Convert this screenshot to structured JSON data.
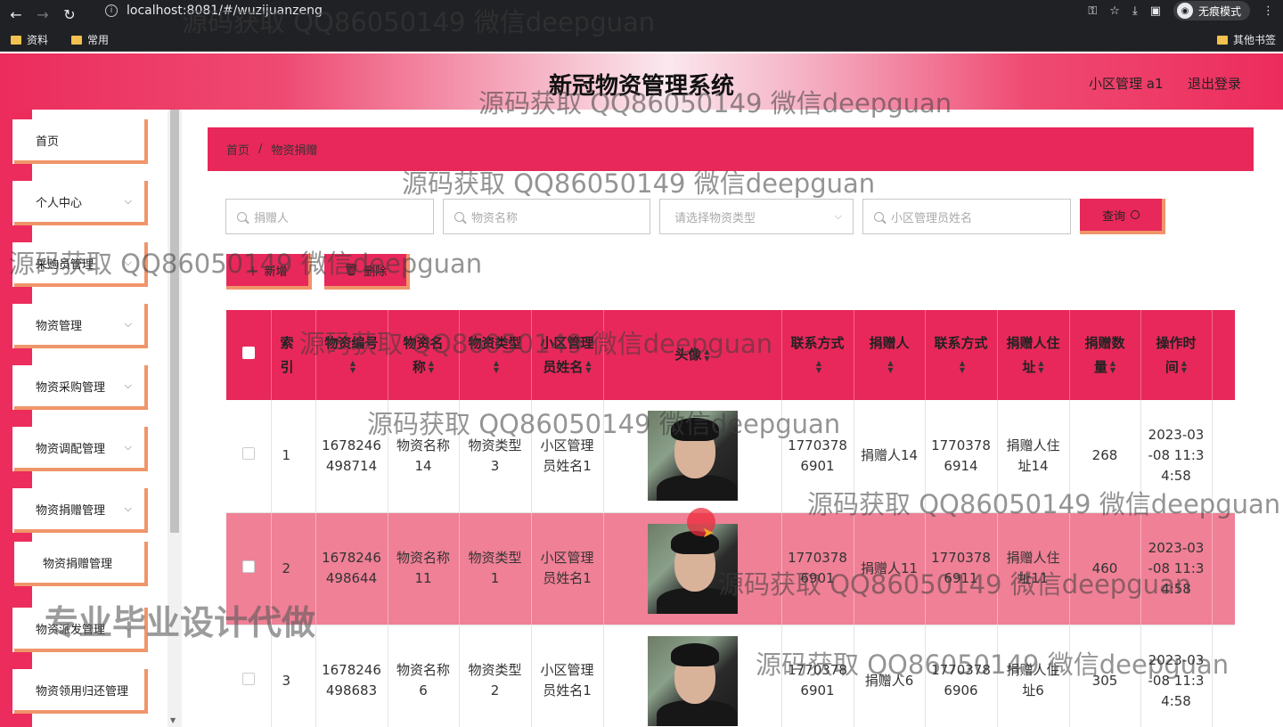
{
  "browser": {
    "url": "localhost:8081/#/wuzijuanzeng",
    "incognito_label": "无痕模式",
    "bookmarks": [
      "资料",
      "常用"
    ],
    "other_bookmarks": "其他书签"
  },
  "header": {
    "title": "新冠物资管理系统",
    "user": "小区管理 a1",
    "logout": "退出登录"
  },
  "sidebar": {
    "items": [
      {
        "label": "首页",
        "has_chevron": false
      },
      {
        "label": "个人中心",
        "has_chevron": true
      },
      {
        "label": "采购员管理",
        "has_chevron": true
      },
      {
        "label": "物资管理",
        "has_chevron": true
      },
      {
        "label": "物资采购管理",
        "has_chevron": true
      },
      {
        "label": "物资调配管理",
        "has_chevron": true
      },
      {
        "label": "物资捐赠管理",
        "has_chevron": true
      },
      {
        "label": "物资捐赠管理",
        "has_chevron": false,
        "submenu": true
      },
      {
        "label": "物资派发管理",
        "has_chevron": true
      },
      {
        "label": "物资领用归还管理",
        "has_chevron": false
      }
    ]
  },
  "breadcrumb": {
    "home": "首页",
    "separator": "/",
    "current": "物资捐赠"
  },
  "search": {
    "donor_placeholder": "捐赠人",
    "name_placeholder": "物资名称",
    "type_placeholder": "请选择物资类型",
    "admin_placeholder": "小区管理员姓名",
    "query_label": "查询"
  },
  "actions": {
    "add_label": "新增",
    "delete_label": "删除"
  },
  "table": {
    "headers": [
      "索引",
      "物资编号",
      "物资名称",
      "物资类型",
      "小区管理员姓名",
      "头像",
      "联系方式",
      "捐赠人",
      "联系方式",
      "捐赠人住址",
      "捐赠数量",
      "操作时间"
    ],
    "rows": [
      {
        "index": "1",
        "code": "1678246498714",
        "name": "物资名称14",
        "type": "物资类型3",
        "admin": "小区管理员姓名1",
        "phone1": "17703786901",
        "donor": "捐赠人14",
        "phone2": "17703786914",
        "address": "捐赠人住址14",
        "qty": "268",
        "time": "2023-03-08 11:34:58"
      },
      {
        "index": "2",
        "code": "1678246498644",
        "name": "物资名称11",
        "type": "物资类型1",
        "admin": "小区管理员姓名1",
        "phone1": "17703786901",
        "donor": "捐赠人11",
        "phone2": "17703786911",
        "address": "捐赠人住址11",
        "qty": "460",
        "time": "2023-03-08 11:34:58"
      },
      {
        "index": "3",
        "code": "1678246498683",
        "name": "物资名称6",
        "type": "物资类型2",
        "admin": "小区管理员姓名1",
        "phone1": "17703786901",
        "donor": "捐赠人6",
        "phone2": "17703786906",
        "address": "捐赠人住址6",
        "qty": "305",
        "time": "2023-03-08 11:34:58"
      }
    ]
  },
  "watermarks": {
    "repeated": "源码获取 QQ86050149 微信deepguan",
    "banner": "专业毕业设计代做"
  }
}
